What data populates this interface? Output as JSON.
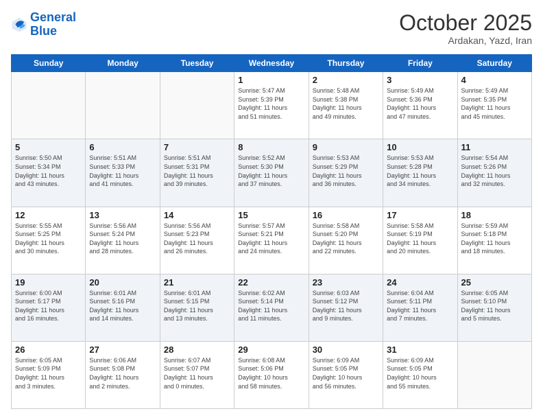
{
  "header": {
    "logo_line1": "General",
    "logo_line2": "Blue",
    "month": "October 2025",
    "location": "Ardakan, Yazd, Iran"
  },
  "weekdays": [
    "Sunday",
    "Monday",
    "Tuesday",
    "Wednesday",
    "Thursday",
    "Friday",
    "Saturday"
  ],
  "weeks": [
    [
      {
        "day": "",
        "info": ""
      },
      {
        "day": "",
        "info": ""
      },
      {
        "day": "",
        "info": ""
      },
      {
        "day": "1",
        "info": "Sunrise: 5:47 AM\nSunset: 5:39 PM\nDaylight: 11 hours\nand 51 minutes."
      },
      {
        "day": "2",
        "info": "Sunrise: 5:48 AM\nSunset: 5:38 PM\nDaylight: 11 hours\nand 49 minutes."
      },
      {
        "day": "3",
        "info": "Sunrise: 5:49 AM\nSunset: 5:36 PM\nDaylight: 11 hours\nand 47 minutes."
      },
      {
        "day": "4",
        "info": "Sunrise: 5:49 AM\nSunset: 5:35 PM\nDaylight: 11 hours\nand 45 minutes."
      }
    ],
    [
      {
        "day": "5",
        "info": "Sunrise: 5:50 AM\nSunset: 5:34 PM\nDaylight: 11 hours\nand 43 minutes."
      },
      {
        "day": "6",
        "info": "Sunrise: 5:51 AM\nSunset: 5:33 PM\nDaylight: 11 hours\nand 41 minutes."
      },
      {
        "day": "7",
        "info": "Sunrise: 5:51 AM\nSunset: 5:31 PM\nDaylight: 11 hours\nand 39 minutes."
      },
      {
        "day": "8",
        "info": "Sunrise: 5:52 AM\nSunset: 5:30 PM\nDaylight: 11 hours\nand 37 minutes."
      },
      {
        "day": "9",
        "info": "Sunrise: 5:53 AM\nSunset: 5:29 PM\nDaylight: 11 hours\nand 36 minutes."
      },
      {
        "day": "10",
        "info": "Sunrise: 5:53 AM\nSunset: 5:28 PM\nDaylight: 11 hours\nand 34 minutes."
      },
      {
        "day": "11",
        "info": "Sunrise: 5:54 AM\nSunset: 5:26 PM\nDaylight: 11 hours\nand 32 minutes."
      }
    ],
    [
      {
        "day": "12",
        "info": "Sunrise: 5:55 AM\nSunset: 5:25 PM\nDaylight: 11 hours\nand 30 minutes."
      },
      {
        "day": "13",
        "info": "Sunrise: 5:56 AM\nSunset: 5:24 PM\nDaylight: 11 hours\nand 28 minutes."
      },
      {
        "day": "14",
        "info": "Sunrise: 5:56 AM\nSunset: 5:23 PM\nDaylight: 11 hours\nand 26 minutes."
      },
      {
        "day": "15",
        "info": "Sunrise: 5:57 AM\nSunset: 5:21 PM\nDaylight: 11 hours\nand 24 minutes."
      },
      {
        "day": "16",
        "info": "Sunrise: 5:58 AM\nSunset: 5:20 PM\nDaylight: 11 hours\nand 22 minutes."
      },
      {
        "day": "17",
        "info": "Sunrise: 5:58 AM\nSunset: 5:19 PM\nDaylight: 11 hours\nand 20 minutes."
      },
      {
        "day": "18",
        "info": "Sunrise: 5:59 AM\nSunset: 5:18 PM\nDaylight: 11 hours\nand 18 minutes."
      }
    ],
    [
      {
        "day": "19",
        "info": "Sunrise: 6:00 AM\nSunset: 5:17 PM\nDaylight: 11 hours\nand 16 minutes."
      },
      {
        "day": "20",
        "info": "Sunrise: 6:01 AM\nSunset: 5:16 PM\nDaylight: 11 hours\nand 14 minutes."
      },
      {
        "day": "21",
        "info": "Sunrise: 6:01 AM\nSunset: 5:15 PM\nDaylight: 11 hours\nand 13 minutes."
      },
      {
        "day": "22",
        "info": "Sunrise: 6:02 AM\nSunset: 5:14 PM\nDaylight: 11 hours\nand 11 minutes."
      },
      {
        "day": "23",
        "info": "Sunrise: 6:03 AM\nSunset: 5:12 PM\nDaylight: 11 hours\nand 9 minutes."
      },
      {
        "day": "24",
        "info": "Sunrise: 6:04 AM\nSunset: 5:11 PM\nDaylight: 11 hours\nand 7 minutes."
      },
      {
        "day": "25",
        "info": "Sunrise: 6:05 AM\nSunset: 5:10 PM\nDaylight: 11 hours\nand 5 minutes."
      }
    ],
    [
      {
        "day": "26",
        "info": "Sunrise: 6:05 AM\nSunset: 5:09 PM\nDaylight: 11 hours\nand 3 minutes."
      },
      {
        "day": "27",
        "info": "Sunrise: 6:06 AM\nSunset: 5:08 PM\nDaylight: 11 hours\nand 2 minutes."
      },
      {
        "day": "28",
        "info": "Sunrise: 6:07 AM\nSunset: 5:07 PM\nDaylight: 11 hours\nand 0 minutes."
      },
      {
        "day": "29",
        "info": "Sunrise: 6:08 AM\nSunset: 5:06 PM\nDaylight: 10 hours\nand 58 minutes."
      },
      {
        "day": "30",
        "info": "Sunrise: 6:09 AM\nSunset: 5:05 PM\nDaylight: 10 hours\nand 56 minutes."
      },
      {
        "day": "31",
        "info": "Sunrise: 6:09 AM\nSunset: 5:05 PM\nDaylight: 10 hours\nand 55 minutes."
      },
      {
        "day": "",
        "info": ""
      }
    ]
  ]
}
